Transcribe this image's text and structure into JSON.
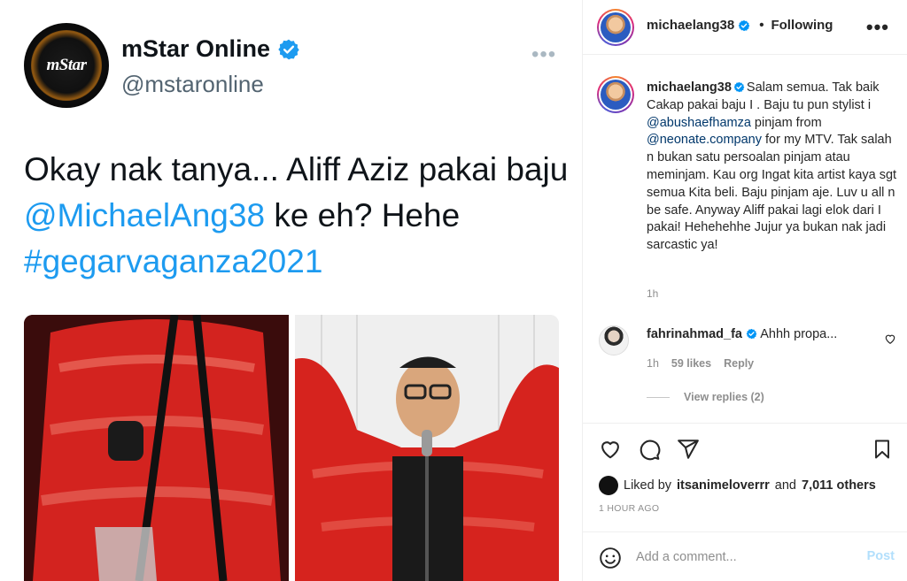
{
  "tweet": {
    "avatar_logo": "mStar",
    "name": "mStar Online",
    "handle": "@mstaronline",
    "more_label": "•••",
    "text_part1": "Okay nak tanya... Aliff Aziz pakai baju ",
    "text_mention": "@MichaelAng38",
    "text_part2": " ke eh? Hehe ",
    "text_hashtag": "#gegarvaganza2021"
  },
  "instagram": {
    "header": {
      "username": "michaelang38",
      "dot": "•",
      "follow_label": "Following",
      "menu_label": "•••"
    },
    "caption": {
      "username": "michaelang38",
      "text_1": "Salam semua. Tak baik Cakap pakai baju I . Baju tu pun stylist i ",
      "mention_1": "@abushaefhamza",
      "text_2": " pinjam from ",
      "mention_2": "@neonate.company",
      "text_3": " for my MTV. Tak salah n bukan satu persoalan pinjam atau meminjam. Kau org Ingat kita artist kaya sgt semua Kita beli. Baju pinjam aje. Luv u all n be safe. Anyway Aliff pakai lagi elok dari I pakai! Hehehehhe Jujur ya bukan nak jadi sarcastic ya!",
      "time": "1h"
    },
    "comment": {
      "username": "fahrinahmad_fa",
      "text": "Ahhh propa...",
      "time": "1h",
      "likes": "59 likes",
      "reply_label": "Reply",
      "view_replies": "View replies (2)"
    },
    "likes": {
      "prefix": "Liked by",
      "user": "itsanimeloverrr",
      "middle": "and",
      "others": "7,011 others"
    },
    "posted": "1 HOUR AGO",
    "add_comment_placeholder": "Add a comment...",
    "post_label": "Post"
  },
  "colors": {
    "twitter_blue": "#1d9bf0",
    "ig_mention": "#00376b",
    "verified": "#0095f6",
    "muted": "#8e8e8e",
    "jacket_red": "#d91c1c"
  }
}
